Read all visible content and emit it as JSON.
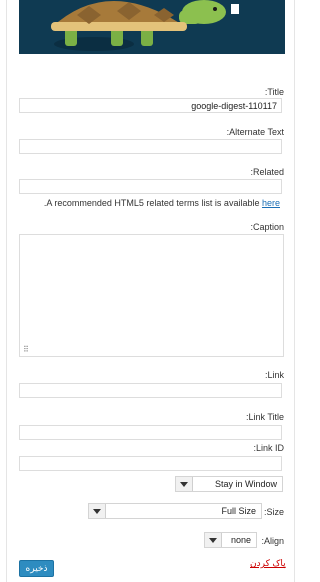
{
  "preview": {
    "image": "turtle-illustration",
    "background": "#0f3a52"
  },
  "fields": {
    "title": {
      "label": ":Title",
      "value": "google-digest-110117"
    },
    "alternate_text": {
      "label": ":Alternate Text",
      "value": ""
    },
    "related": {
      "label": ":Related",
      "value": ""
    },
    "related_note": {
      "text": ".A recommended HTML5 related terms list is available",
      "link": "here"
    },
    "caption": {
      "label": ":Caption",
      "value": ""
    },
    "link": {
      "label": ":Link",
      "value": ""
    },
    "link_title": {
      "label": ":Link Title",
      "value": ""
    },
    "link_id": {
      "label": ":Link ID",
      "value": ""
    },
    "window_target": {
      "selected": "Stay in Window"
    },
    "size": {
      "label": ":Size",
      "selected": "Full Size"
    },
    "align": {
      "label": ":Align",
      "selected": "none"
    }
  },
  "actions": {
    "save_label": "ذخیره",
    "clear_label": "پاک کردن"
  },
  "colors": {
    "accent": "#2e8cc0",
    "link": "#1a6eb5",
    "danger": "#cc0000"
  }
}
